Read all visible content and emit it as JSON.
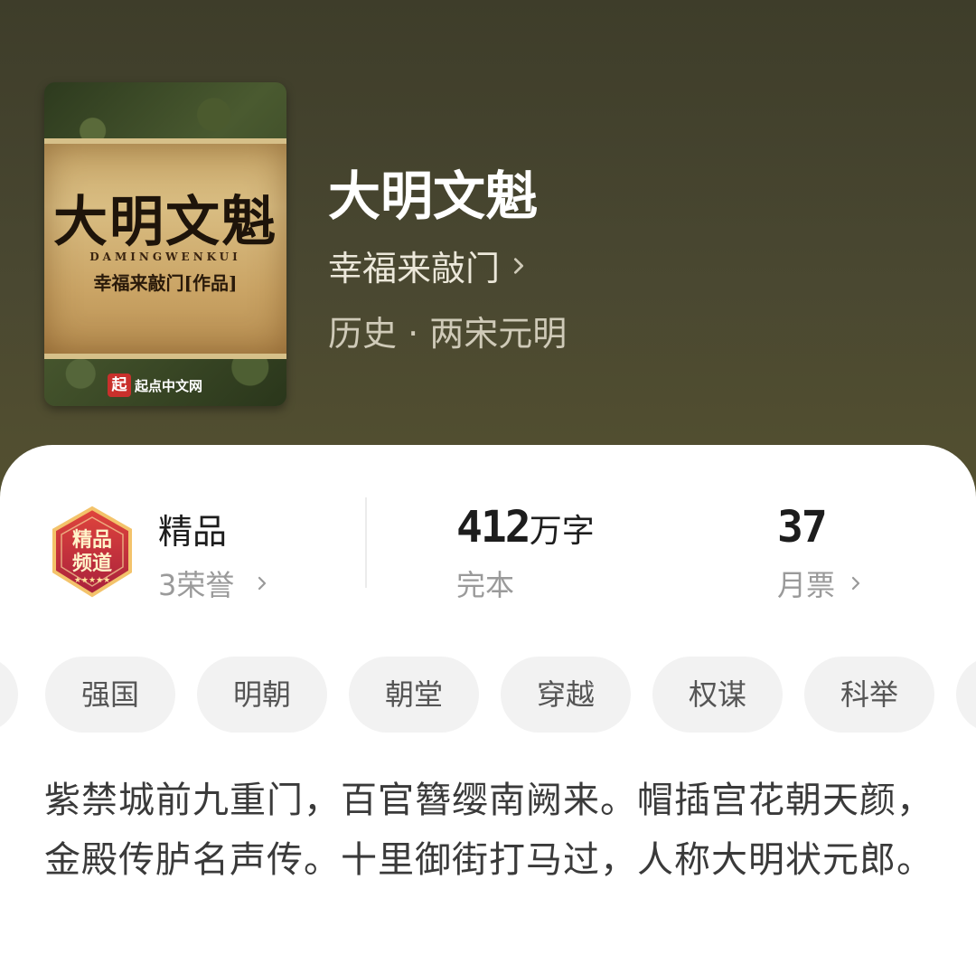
{
  "book": {
    "title": "大明文魁",
    "author": "幸福来敲门",
    "genre": "历史 · 两宋元明",
    "cover": {
      "title": "大明文魁",
      "pinyin": "DAMINGWENKUI",
      "author_line": "幸福来敲门[作品]",
      "publisher_mark": "起",
      "publisher": "起点中文网"
    }
  },
  "stats": {
    "honor": {
      "label": "精品",
      "sub": "3荣誉",
      "badge_icon": "premium-channel-badge-icon"
    },
    "words": {
      "value": "412",
      "unit": "万字",
      "sub": "完本"
    },
    "tickets": {
      "value": "37",
      "sub": "月票"
    }
  },
  "tags": [
    "强国",
    "明朝",
    "朝堂",
    "穿越",
    "权谋",
    "科举"
  ],
  "description": "紫禁城前九重门，百官簪缨南阙来。帽插宫花朝天颜，金殿传胪名声传。十里御街打马过，人称大明状元郎。",
  "colors": {
    "header_bg": "#4a4831",
    "card_bg": "#ffffff",
    "tag_bg": "#f2f2f2"
  }
}
